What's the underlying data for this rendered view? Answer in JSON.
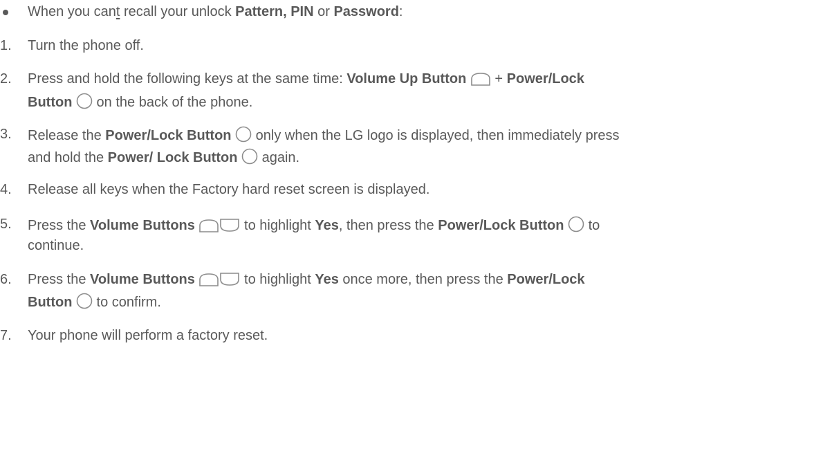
{
  "intro": {
    "a": "When you can",
    "apos": "t",
    "b": " recall your unlock ",
    "pattern": "Pattern, PIN",
    "or": " or ",
    "password": "Password",
    "colon": ":"
  },
  "steps": [
    {
      "num": "1.",
      "text": "Turn the phone off."
    },
    {
      "num": "2.",
      "a": "Press and hold the following keys at the same time: ",
      "vol_up": "Volume Up Button",
      "plus": " + ",
      "power_lock": "Power/Lock",
      "button": "Button",
      "rest": " on the back of the phone."
    },
    {
      "num": "3.",
      "a": "Release the ",
      "power_lock_button": "Power/Lock Button",
      "b": " only when the LG logo is displayed, then immediately press",
      "c": "and hold the ",
      "power_lock_button2": "Power/ Lock Button",
      "d": " again."
    },
    {
      "num": "4.",
      "text": "Release all keys when the Factory hard reset screen is displayed."
    },
    {
      "num": "5.",
      "a": "Press the ",
      "volume_buttons": "Volume Buttons",
      "b": " to highlight ",
      "yes": "Yes",
      "c": ", then press the ",
      "power_lock_button": "Power/Lock Button",
      "d": " to",
      "e": "continue."
    },
    {
      "num": "6.",
      "a": "Press the ",
      "volume_buttons": "Volume Buttons",
      "b": " to highlight ",
      "yes": "Yes",
      "c": " once more, then press the ",
      "power_lock": "Power/Lock",
      "button": "Button",
      "d": " to confirm."
    },
    {
      "num": "7.",
      "text": "Your phone will perform a factory reset."
    }
  ],
  "icons": {
    "volume_up": "volume-up-button-icon",
    "volume_down": "volume-down-button-icon",
    "power_lock": "power-lock-button-icon",
    "stroke_color": "#8c8c8c",
    "fill_color": "#ffffff"
  }
}
